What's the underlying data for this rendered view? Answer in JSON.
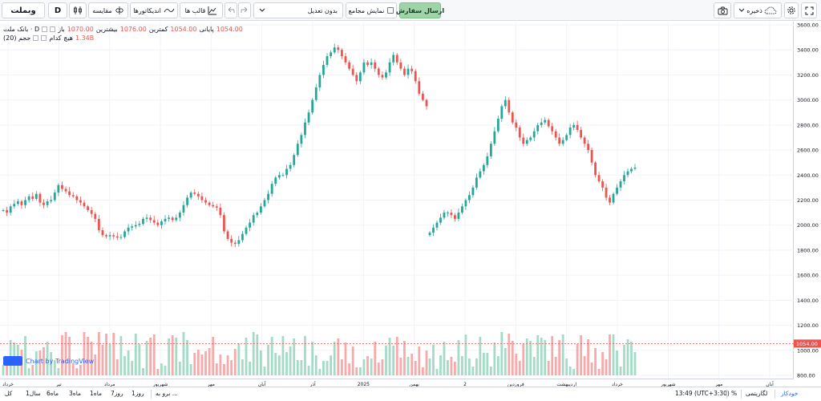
{
  "toolbar": {
    "symbol": "وبملت",
    "interval": "D",
    "compare_label": "مقایسه",
    "indicators_label": "اندیکاتورها",
    "templates_label": "قالب ها",
    "adjustment_label": "بدون تعدیل",
    "aggregate_label": "نمایش مجامع",
    "order_button_label": "ارسال سفارش",
    "save_label": "ذخیره"
  },
  "legend": {
    "title": "بانک ملت · D",
    "open_label": "باز",
    "open_value": "1070.00",
    "high_label": "بیشترین",
    "high_value": "1076.00",
    "low_label": "کمترین",
    "low_value": "1054.00",
    "close_label": "پایانی",
    "close_value": "1054.00",
    "volume_title": "حجم (20)",
    "volume_label": "هیچ کدام",
    "volume_value": "1.34B"
  },
  "watermark": "Chart by TradingView",
  "price_axis": {
    "ticks": [
      "3600.00",
      "3400.00",
      "3200.00",
      "3000.00",
      "2800.00",
      "2600.00",
      "2400.00",
      "2200.00",
      "2000.00",
      "1800.00",
      "1600.00",
      "1400.00",
      "1200.00",
      "1000.00",
      "800.00"
    ],
    "last_price_label": "1054.00"
  },
  "time_axis": {
    "labels": [
      "خرداد",
      "تیر",
      "مرداد",
      "شهریور",
      "مهر",
      "آبان",
      "آذر",
      "2025",
      "بهمن",
      "2",
      "فروردین",
      "اردیبهشت",
      "خرداد",
      "شهریور",
      "مهر",
      "آبان"
    ]
  },
  "bottom_bar": {
    "ranges": [
      "کل",
      "1سال",
      "6ماه",
      "3ماه",
      "1ماه",
      "7روز",
      "1روز"
    ],
    "goto_label": "برو به ...",
    "clock": "13:49 (UTC+3:30)",
    "percent_label": "%",
    "log_label": "لگاریتمی",
    "auto_label": "خودکار"
  },
  "colors": {
    "up": "#26a69a",
    "down": "#ef5350",
    "volume_up": "#a5dbc6",
    "volume_down": "#f7aaa9",
    "accent": "#2962ff"
  },
  "chart_data": {
    "type": "candlestick",
    "symbol": "بانک ملت",
    "interval": "D",
    "ylim": [
      800,
      3600
    ],
    "segments": [
      {
        "name": "before_gap",
        "closes": [
          2120,
          2100,
          2150,
          2170,
          2190,
          2160,
          2200,
          2230,
          2210,
          2250,
          2180,
          2160,
          2190,
          2200,
          2260,
          2320,
          2290,
          2270,
          2240,
          2230,
          2200,
          2180,
          2150,
          2120,
          2090,
          2050,
          1960,
          1920,
          1910,
          1920,
          1910,
          1900,
          1905,
          1950,
          1980,
          1990,
          2000,
          2010,
          2050,
          2060,
          2040,
          2020,
          2000,
          2030,
          2050,
          2060,
          2040,
          2060,
          2100,
          2160,
          2220,
          2260,
          2250,
          2230,
          2200,
          2180,
          2160,
          2150,
          2140,
          2080,
          1950,
          1890,
          1860,
          1850,
          1880,
          1930,
          1980,
          2020,
          2080,
          2100,
          2150,
          2200,
          2250,
          2330,
          2380,
          2400,
          2400,
          2450,
          2480,
          2560,
          2650,
          2720,
          2820,
          2900,
          3000,
          3100,
          3200,
          3280,
          3350,
          3380,
          3420,
          3400,
          3350,
          3300,
          3250,
          3200,
          3150,
          3220,
          3300,
          3280,
          3300,
          3250,
          3200,
          3180,
          3220,
          3300,
          3360,
          3300,
          3250,
          3200,
          3250,
          3230,
          3150,
          3050,
          3000,
          2950
        ]
      },
      {
        "name": "after_gap",
        "closes": [
          1940,
          1980,
          2020,
          2060,
          2100,
          2100,
          2080,
          2050,
          2100,
          2150,
          2200,
          2240,
          2300,
          2380,
          2430,
          2480,
          2550,
          2650,
          2750,
          2850,
          2950,
          3000,
          2900,
          2820,
          2780,
          2700,
          2650,
          2680,
          2700,
          2750,
          2800,
          2820,
          2840,
          2790,
          2750,
          2700,
          2650,
          2680,
          2720,
          2780,
          2800,
          2760,
          2700,
          2650,
          2600,
          2500,
          2400,
          2350,
          2300,
          2220,
          2180,
          2250,
          2300,
          2350,
          2400,
          2430,
          2450,
          2460
        ]
      }
    ],
    "volume_y_range_in_price_units": [
      800,
      1500
    ],
    "last_price": 1054.0
  }
}
